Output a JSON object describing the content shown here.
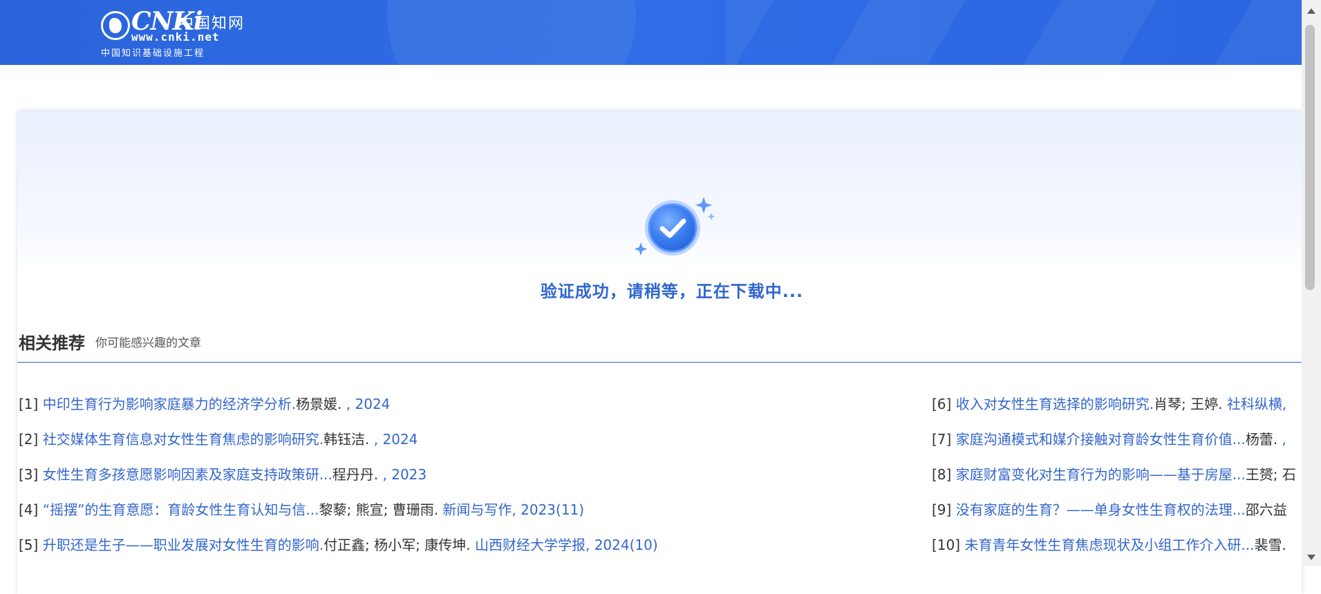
{
  "header": {
    "logo_brand": "CNKi",
    "logo_cn_name": "中国知网",
    "logo_url": "www.cnki.net",
    "logo_slogan": "中国知识基础设施工程",
    "background_color": "#2a64db"
  },
  "status": {
    "icon": "check-icon",
    "message": "验证成功，请稍等，正在下载中..."
  },
  "recommendations": {
    "title": "相关推荐",
    "subtitle": "你可能感兴趣的文章",
    "left_column": [
      {
        "index": "[1]",
        "title": "中印生育行为影响家庭暴力的经济学分析.",
        "authors": "杨景媛.",
        "source": " , 2024"
      },
      {
        "index": "[2]",
        "title": "社交媒体生育信息对女性生育焦虑的影响研究.",
        "authors": "韩钰洁.",
        "source": " , 2024"
      },
      {
        "index": "[3]",
        "title": "女性生育多孩意愿影响因素及家庭支持政策研...",
        "authors": "程丹丹.",
        "source": " , 2023"
      },
      {
        "index": "[4]",
        "title": "“摇摆”的生育意愿：育龄女性生育认知与信...",
        "authors": "黎藜; 熊宣; 曹珊雨.",
        "source": " 新闻与写作, 2023(11)"
      },
      {
        "index": "[5]",
        "title": "升职还是生子——职业发展对女性生育的影响.",
        "authors": "付正鑫; 杨小军; 康传坤.",
        "source": " 山西财经大学学报, 2024(10)"
      }
    ],
    "right_column": [
      {
        "index": "[6]",
        "title": "收入对女性生育选择的影响研究.",
        "authors": "肖琴; 王婷.",
        "source": " 社科纵横,"
      },
      {
        "index": "[7]",
        "title": "家庭沟通模式和媒介接触对育龄女性生育价值...",
        "authors": "杨蕾.",
        "source": " ,"
      },
      {
        "index": "[8]",
        "title": "家庭财富变化对生育行为的影响——基于房屋...",
        "authors": "王赟; 石",
        "source": ""
      },
      {
        "index": "[9]",
        "title": "没有家庭的生育？——单身女性生育权的法理...",
        "authors": "邵六益",
        "source": ""
      },
      {
        "index": "[10]",
        "title": "未育青年女性生育焦虑现状及小组工作介入研...",
        "authors": "裴雪.",
        "source": ""
      }
    ]
  },
  "colors": {
    "accent": "#2f66cc",
    "link": "#3366cc"
  }
}
